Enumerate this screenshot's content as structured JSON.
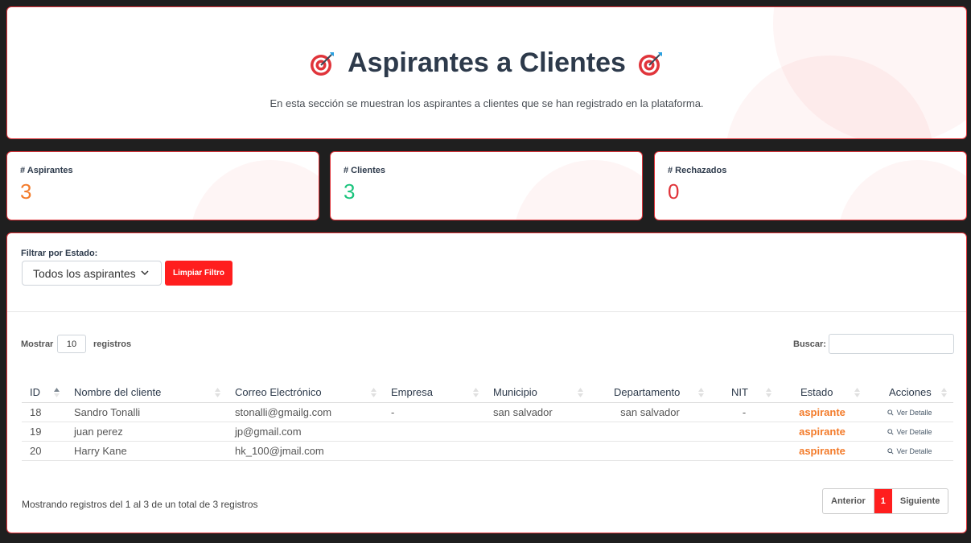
{
  "header": {
    "title": "Aspirantes a Clientes",
    "subtitle": "En esta sección se muestran los aspirantes a clientes que se han registrado en la plataforma."
  },
  "stats": [
    {
      "label": "# Aspirantes",
      "value": "3",
      "color": "#f37b2a"
    },
    {
      "label": "# Clientes",
      "value": "3",
      "color": "#1bc47d"
    },
    {
      "label": "# Rechazados",
      "value": "0",
      "color": "#e0343a"
    }
  ],
  "filter": {
    "label": "Filtrar por Estado:",
    "selected": "Todos los aspirantes",
    "clear_button": "Limpiar Filtro"
  },
  "table_controls": {
    "show_prefix": "Mostrar",
    "show_value": "10",
    "show_suffix": "registros",
    "search_label": "Buscar:",
    "search_value": ""
  },
  "table": {
    "columns": [
      "ID",
      "Nombre del cliente",
      "Correo Electrónico",
      "Empresa",
      "Municipio",
      "Departamento",
      "NIT",
      "Estado",
      "Acciones"
    ],
    "rows": [
      {
        "id": "18",
        "nombre": "Sandro Tonalli",
        "correo": "stonalli@gmailg.com",
        "empresa": "-",
        "municipio": "san salvador",
        "departamento": "san salvador",
        "nit": "-",
        "estado": "aspirante",
        "accion": "Ver Detalle"
      },
      {
        "id": "19",
        "nombre": "juan perez",
        "correo": "jp@gmail.com",
        "empresa": "",
        "municipio": "",
        "departamento": "",
        "nit": "",
        "estado": "aspirante",
        "accion": "Ver Detalle"
      },
      {
        "id": "20",
        "nombre": "Harry Kane",
        "correo": "hk_100@jmail.com",
        "empresa": "",
        "municipio": "",
        "departamento": "",
        "nit": "",
        "estado": "aspirante",
        "accion": "Ver Detalle"
      }
    ]
  },
  "footer": {
    "info": "Mostrando registros del 1 al 3 de un total de 3 registros",
    "prev": "Anterior",
    "page": "1",
    "next": "Siguiente"
  },
  "colors": {
    "accent": "#ff1e1e",
    "border": "#e0343a",
    "estado": "#f37b2a",
    "title": "#2d3a4b"
  },
  "icons": {
    "title_icon": "dart-target-icon",
    "select_icon": "chevron-down-icon",
    "action_icon": "magnifier-icon",
    "sort_icon": "sort-arrows-icon"
  }
}
